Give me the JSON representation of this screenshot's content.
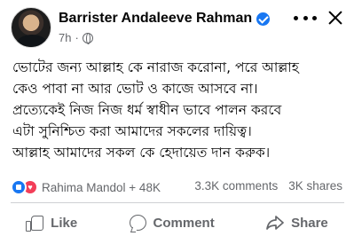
{
  "post": {
    "author": "Barrister Andaleeve Rahman",
    "time": "7h",
    "separator": "·",
    "lines": [
      "ভোটের জন্য আল্লাহ কে নারাজ করোনা, পরে আল্লাহ",
      "কেও পাবা না আর ভোট ও কাজে আসবে না।",
      "প্রত্যেকেই নিজ নিজ ধর্ম স্বাধীন ভাবে পালন করবে",
      "এটা সুনিশ্চিত করা আমাদের সকলের দায়িত্ব।",
      "আল্লাহ আমাদের সকল কে হেদায়েত দান করুক।"
    ]
  },
  "stats": {
    "reactors": "Rahima Mandol + 48K",
    "comments": "3.3K comments",
    "shares": "3K shares"
  },
  "actions": {
    "like": "Like",
    "comment": "Comment",
    "share": "Share"
  },
  "colors": {
    "verified": "#1877f2",
    "like": "#1877f2",
    "love": "#f33e58",
    "secondary_text": "#65676b"
  },
  "icons": [
    "verified-badge-icon",
    "globe-icon",
    "more-options-icon",
    "close-icon",
    "like-reaction-icon",
    "love-reaction-icon",
    "like-icon",
    "comment-icon",
    "share-icon"
  ]
}
